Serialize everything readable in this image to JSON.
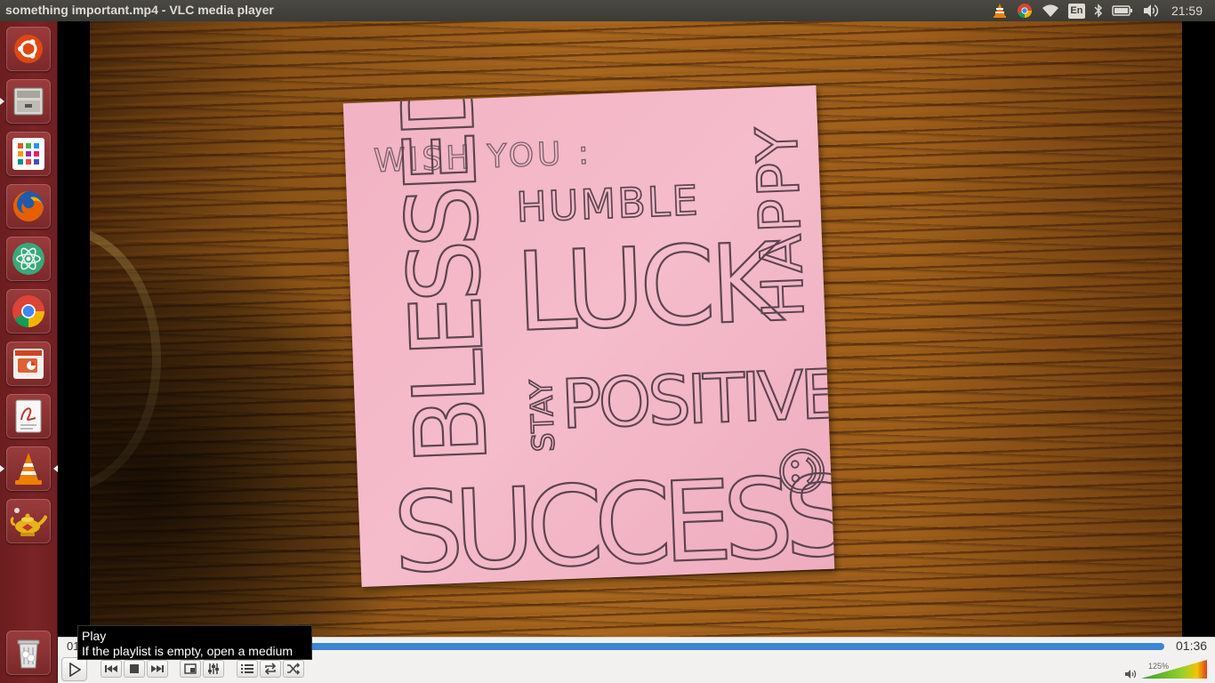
{
  "window": {
    "title": "something important.mp4 - VLC media player"
  },
  "panel": {
    "keyboard_layout": "En",
    "clock": "21:59",
    "indicators": [
      "vlc-tray-icon",
      "chrome-tray-icon",
      "wifi-icon",
      "keyboard-layout-icon",
      "bluetooth-icon",
      "battery-icon",
      "volume-icon"
    ]
  },
  "launcher": {
    "items": [
      {
        "name": "dash-home",
        "icon": "ubuntu-logo-icon"
      },
      {
        "name": "files",
        "icon": "file-cabinet-icon"
      },
      {
        "name": "software-center",
        "icon": "app-grid-icon"
      },
      {
        "name": "firefox",
        "icon": "firefox-icon"
      },
      {
        "name": "atom",
        "icon": "atom-icon"
      },
      {
        "name": "chrome",
        "icon": "chrome-icon"
      },
      {
        "name": "presentation",
        "icon": "presentation-icon"
      },
      {
        "name": "document-viewer",
        "icon": "document-viewer-icon"
      },
      {
        "name": "vlc",
        "icon": "vlc-cone-icon"
      },
      {
        "name": "genie-lamp",
        "icon": "lamp-icon"
      }
    ],
    "trash": {
      "icon": "trash-icon"
    }
  },
  "video": {
    "note_words": [
      "WISH YOU :",
      "HUMBLE",
      "BLESSED",
      "LUCK",
      "HAPPY",
      "STAY",
      "POSITIVE",
      "SUCCESS",
      "☺"
    ]
  },
  "controls": {
    "time_elapsed": "01",
    "time_total": "01:36",
    "progress_fraction": 1.0,
    "volume_label": "125%",
    "volume_fraction": 1.0,
    "accent": "#3c86d2"
  },
  "tooltip": {
    "title": "Play",
    "body": "If the playlist is empty, open a medium"
  }
}
